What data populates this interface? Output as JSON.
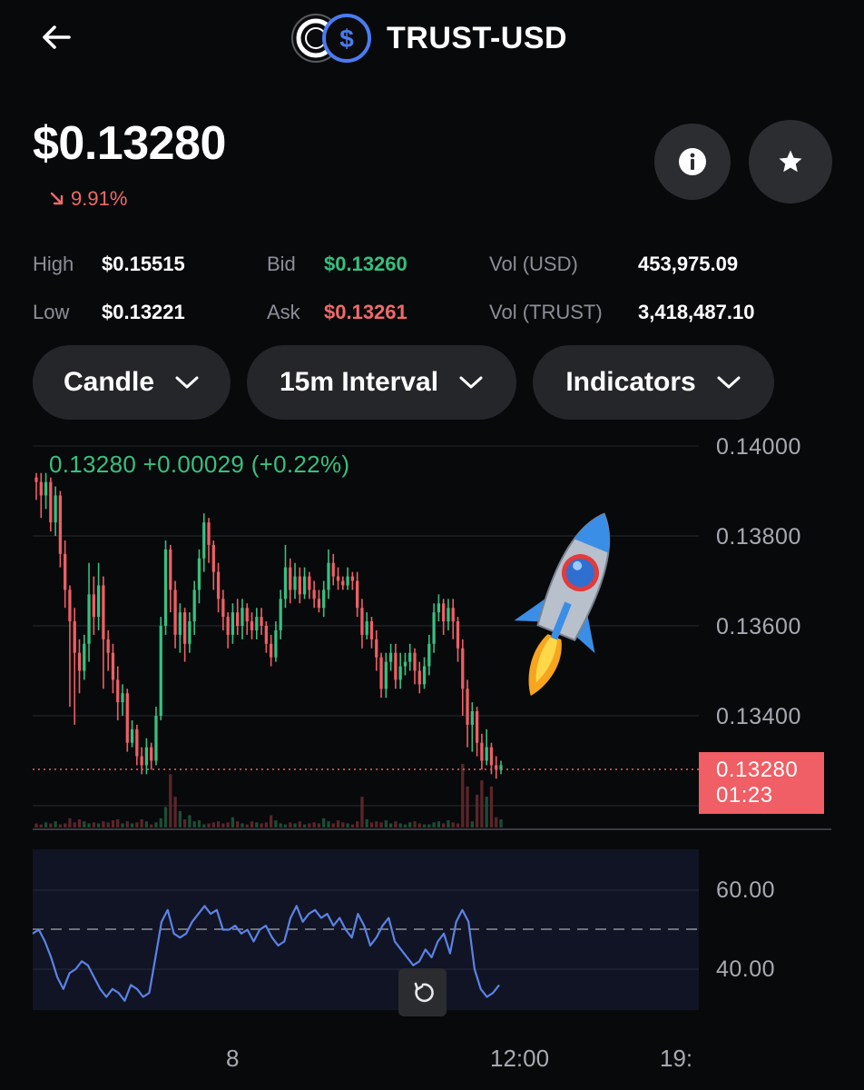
{
  "header": {
    "back_icon": "arrow-left-icon",
    "pair": "TRUST-USD",
    "coin_icons": [
      "trust-coin-icon",
      "usd-coin-icon"
    ]
  },
  "price": {
    "current": "$0.13280",
    "change": "9.91%",
    "change_direction": "down",
    "info_icon": "info-icon",
    "favorite_icon": "star-icon"
  },
  "stats": {
    "high_label": "High",
    "high": "$0.15515",
    "low_label": "Low",
    "low": "$0.13221",
    "bid_label": "Bid",
    "bid": "$0.13260",
    "ask_label": "Ask",
    "ask": "$0.13261",
    "vol_usd_label": "Vol (USD)",
    "vol_usd": "453,975.09",
    "vol_trust_label": "Vol (TRUST)",
    "vol_trust": "3,418,487.10"
  },
  "controls": {
    "chart_type": "Candle",
    "interval": "15m Interval",
    "indicators": "Indicators"
  },
  "chart": {
    "ohlc_readout": "0.13280  +0.00029 (+0.22%)",
    "price_axis": [
      "0.14000",
      "0.13800",
      "0.13600",
      "0.13400"
    ],
    "last_price": "0.13280",
    "countdown": "01:23",
    "rsi_axis": [
      "60.00",
      "40.00"
    ],
    "time_axis": [
      "8",
      "12:00",
      "19:"
    ],
    "colors": {
      "up": "#36c080",
      "down": "#ef5f65",
      "rsi": "#5b82e6"
    }
  },
  "chart_data": [
    {
      "type": "candlestick",
      "title": "",
      "ylim": [
        0.1328,
        0.14
      ],
      "y_ticks": [
        0.134,
        0.136,
        0.138,
        0.14
      ],
      "x_ticks": [
        "8",
        "12:00",
        "19:"
      ],
      "last_price": 0.1328,
      "candles": [
        [
          0.1393,
          0.1392,
          0.1394,
          0.1388
        ],
        [
          0.1392,
          0.1389,
          0.1394,
          0.1384
        ],
        [
          0.1389,
          0.1392,
          0.1394,
          0.1386
        ],
        [
          0.1392,
          0.1383,
          0.1393,
          0.1381
        ],
        [
          0.1383,
          0.1389,
          0.1391,
          0.138
        ],
        [
          0.1389,
          0.1376,
          0.139,
          0.1373
        ],
        [
          0.1376,
          0.1368,
          0.1379,
          0.1364
        ],
        [
          0.1368,
          0.1361,
          0.1369,
          0.1342
        ],
        [
          0.1361,
          0.1354,
          0.1364,
          0.1338
        ],
        [
          0.1354,
          0.135,
          0.1357,
          0.1345
        ],
        [
          0.135,
          0.1356,
          0.1358,
          0.1348
        ],
        [
          0.1356,
          0.1367,
          0.1374,
          0.1352
        ],
        [
          0.1367,
          0.1362,
          0.1371,
          0.1358
        ],
        [
          0.1362,
          0.1369,
          0.1374,
          0.1359
        ],
        [
          0.1369,
          0.1357,
          0.1371,
          0.1346
        ],
        [
          0.1357,
          0.1354,
          0.1359,
          0.135
        ],
        [
          0.1354,
          0.1348,
          0.1356,
          0.1345
        ],
        [
          0.1348,
          0.1343,
          0.1351,
          0.1339
        ],
        [
          0.1343,
          0.1345,
          0.1347,
          0.134
        ],
        [
          0.1345,
          0.1334,
          0.1346,
          0.1332
        ],
        [
          0.1334,
          0.1337,
          0.1339,
          0.1333
        ],
        [
          0.1337,
          0.1331,
          0.1338,
          0.1329
        ],
        [
          0.1331,
          0.1329,
          0.1333,
          0.1327
        ],
        [
          0.1329,
          0.1333,
          0.1335,
          0.1327
        ],
        [
          0.1333,
          0.133,
          0.1334,
          0.1328
        ],
        [
          0.133,
          0.134,
          0.1342,
          0.1329
        ],
        [
          0.134,
          0.136,
          0.1362,
          0.1339
        ],
        [
          0.136,
          0.1377,
          0.1379,
          0.1358
        ],
        [
          0.1377,
          0.1368,
          0.1378,
          0.1363
        ],
        [
          0.1368,
          0.1358,
          0.137,
          0.1355
        ],
        [
          0.1358,
          0.1363,
          0.1365,
          0.1354
        ],
        [
          0.1363,
          0.1356,
          0.1364,
          0.1352
        ],
        [
          0.1356,
          0.1361,
          0.1363,
          0.1354
        ],
        [
          0.1361,
          0.1368,
          0.137,
          0.1358
        ],
        [
          0.1368,
          0.1375,
          0.1377,
          0.1365
        ],
        [
          0.1375,
          0.1383,
          0.1385,
          0.1372
        ],
        [
          0.1383,
          0.1378,
          0.1384,
          0.1374
        ],
        [
          0.1378,
          0.1372,
          0.1379,
          0.1368
        ],
        [
          0.1372,
          0.1366,
          0.1374,
          0.1363
        ],
        [
          0.1366,
          0.1362,
          0.1368,
          0.1359
        ],
        [
          0.1362,
          0.1358,
          0.1363,
          0.1355
        ],
        [
          0.1358,
          0.1363,
          0.1365,
          0.1356
        ],
        [
          0.1363,
          0.136,
          0.1366,
          0.1358
        ],
        [
          0.136,
          0.1364,
          0.1366,
          0.1357
        ],
        [
          0.1364,
          0.1361,
          0.1365,
          0.1358
        ],
        [
          0.1361,
          0.1359,
          0.1363,
          0.1357
        ],
        [
          0.1359,
          0.1362,
          0.1364,
          0.1357
        ],
        [
          0.1362,
          0.136,
          0.1364,
          0.1358
        ],
        [
          0.136,
          0.1356,
          0.1361,
          0.1354
        ],
        [
          0.1356,
          0.1353,
          0.1358,
          0.1351
        ],
        [
          0.1353,
          0.1359,
          0.1361,
          0.1352
        ],
        [
          0.1359,
          0.1366,
          0.1368,
          0.1357
        ],
        [
          0.1366,
          0.1373,
          0.1378,
          0.1364
        ],
        [
          0.1373,
          0.1368,
          0.1375,
          0.1365
        ],
        [
          0.1368,
          0.1371,
          0.1374,
          0.1366
        ],
        [
          0.1371,
          0.1367,
          0.1373,
          0.1365
        ],
        [
          0.1367,
          0.1371,
          0.1373,
          0.1366
        ],
        [
          0.1371,
          0.1368,
          0.1372,
          0.1366
        ],
        [
          0.1368,
          0.1366,
          0.137,
          0.1364
        ],
        [
          0.1366,
          0.1364,
          0.1368,
          0.1363
        ],
        [
          0.1364,
          0.1368,
          0.137,
          0.1362
        ],
        [
          0.1368,
          0.1374,
          0.1377,
          0.1366
        ],
        [
          0.1374,
          0.1371,
          0.1376,
          0.1369
        ],
        [
          0.1371,
          0.137,
          0.1373,
          0.1368
        ],
        [
          0.137,
          0.1369,
          0.1371,
          0.1368
        ],
        [
          0.1369,
          0.1371,
          0.1373,
          0.1368
        ],
        [
          0.1371,
          0.137,
          0.1372,
          0.1368
        ],
        [
          0.137,
          0.1364,
          0.1372,
          0.1362
        ],
        [
          0.1364,
          0.1358,
          0.1366,
          0.1355
        ],
        [
          0.1358,
          0.1361,
          0.1363,
          0.1357
        ],
        [
          0.1361,
          0.1357,
          0.1362,
          0.1355
        ],
        [
          0.1357,
          0.1353,
          0.1359,
          0.135
        ],
        [
          0.1353,
          0.1346,
          0.1354,
          0.1344
        ],
        [
          0.1346,
          0.1352,
          0.1354,
          0.1344
        ],
        [
          0.1352,
          0.1354,
          0.1356,
          0.135
        ],
        [
          0.1354,
          0.1348,
          0.1356,
          0.1346
        ],
        [
          0.1348,
          0.1351,
          0.1354,
          0.1346
        ],
        [
          0.1351,
          0.1352,
          0.1354,
          0.1349
        ],
        [
          0.1352,
          0.1354,
          0.1356,
          0.135
        ],
        [
          0.1354,
          0.135,
          0.1355,
          0.1347
        ],
        [
          0.135,
          0.1347,
          0.1352,
          0.1345
        ],
        [
          0.1347,
          0.1351,
          0.1353,
          0.1346
        ],
        [
          0.1351,
          0.1356,
          0.1358,
          0.1349
        ],
        [
          0.1356,
          0.1363,
          0.1365,
          0.1354
        ],
        [
          0.1363,
          0.1365,
          0.1367,
          0.1361
        ],
        [
          0.1365,
          0.1361,
          0.1366,
          0.1358
        ],
        [
          0.1361,
          0.1364,
          0.1366,
          0.1359
        ],
        [
          0.1364,
          0.1361,
          0.1366,
          0.1357
        ],
        [
          0.1361,
          0.1355,
          0.1362,
          0.1352
        ],
        [
          0.1355,
          0.1346,
          0.1357,
          0.134
        ],
        [
          0.1346,
          0.1338,
          0.1348,
          0.1333
        ],
        [
          0.1338,
          0.1341,
          0.1343,
          0.1332
        ],
        [
          0.1341,
          0.1334,
          0.1342,
          0.1331
        ],
        [
          0.1334,
          0.133,
          0.1336,
          0.1328
        ],
        [
          0.133,
          0.1333,
          0.1337,
          0.1329
        ],
        [
          0.1333,
          0.1329,
          0.1334,
          0.1327
        ],
        [
          0.1329,
          0.1328,
          0.1331,
          0.1326
        ],
        [
          0.1328,
          0.1329,
          0.133,
          0.1327
        ]
      ],
      "volume": [
        4,
        3,
        5,
        4,
        6,
        3,
        4,
        9,
        5,
        8,
        6,
        4,
        5,
        4,
        6,
        5,
        7,
        8,
        4,
        6,
        4,
        5,
        8,
        6,
        3,
        5,
        9,
        20,
        52,
        30,
        16,
        8,
        12,
        6,
        7,
        3,
        4,
        5,
        6,
        4,
        5,
        10,
        6,
        4,
        3,
        6,
        5,
        4,
        5,
        12,
        7,
        4,
        3,
        5,
        4,
        6,
        3,
        4,
        5,
        4,
        9,
        6,
        4,
        7,
        5,
        4,
        3,
        6,
        30,
        8,
        5,
        6,
        5,
        7,
        4,
        6,
        4,
        3,
        5,
        6,
        4,
        3,
        3,
        5,
        6,
        4,
        7,
        5,
        4,
        62,
        40,
        6,
        32,
        46,
        30,
        40,
        10,
        8
      ]
    },
    {
      "type": "line",
      "title": "",
      "ylim": [
        30,
        70
      ],
      "y_ticks": [
        40,
        60
      ],
      "reference_line": 50,
      "series": [
        {
          "values": [
            49,
            50,
            47,
            43,
            38,
            35,
            39,
            40,
            42,
            41,
            38,
            35,
            33,
            35,
            34,
            32,
            36,
            35,
            33,
            34,
            43,
            52,
            55,
            49,
            48,
            49,
            52,
            54,
            56,
            54,
            55,
            50,
            50,
            51,
            49,
            50,
            47,
            50,
            51,
            48,
            46,
            47,
            53,
            56,
            52,
            54,
            55,
            53,
            54,
            51,
            53,
            50,
            48,
            54,
            51,
            46,
            48,
            51,
            53,
            47,
            45,
            43,
            41,
            42,
            45,
            43,
            47,
            49,
            44,
            52,
            55,
            52,
            40,
            35,
            33,
            34,
            36
          ]
        }
      ]
    }
  ]
}
